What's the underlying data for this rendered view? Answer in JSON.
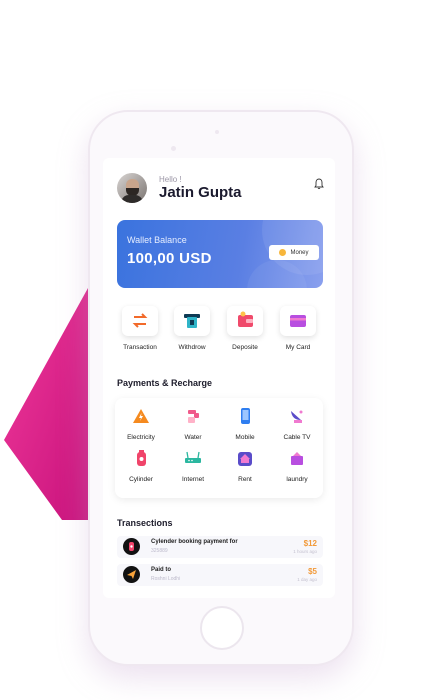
{
  "header": {
    "greeting": "Hello !",
    "user_name": "Jatin Gupta"
  },
  "wallet": {
    "label": "Wallet Balance",
    "balance": "100,00 USD",
    "money_button": "Money"
  },
  "quick_actions": [
    {
      "label": "Transaction",
      "icon": "transfer-arrows-icon"
    },
    {
      "label": "Withdrow",
      "icon": "atm-withdraw-icon"
    },
    {
      "label": "Deposite",
      "icon": "wallet-deposit-icon"
    },
    {
      "label": "My Card",
      "icon": "credit-card-icon"
    }
  ],
  "payments": {
    "title": "Payments & Recharge",
    "items": [
      {
        "label": "Electricity",
        "icon": "electricity-icon"
      },
      {
        "label": "Water",
        "icon": "water-tap-icon"
      },
      {
        "label": "Mobile",
        "icon": "mobile-phone-icon"
      },
      {
        "label": "Cable TV",
        "icon": "satellite-dish-icon"
      },
      {
        "label": "Cylinder",
        "icon": "gas-cylinder-icon"
      },
      {
        "label": "Internet",
        "icon": "router-icon"
      },
      {
        "label": "Rent",
        "icon": "house-rent-icon"
      },
      {
        "label": "laundry",
        "icon": "laundry-icon"
      }
    ]
  },
  "transactions": {
    "title": "Transections",
    "items": [
      {
        "title": "Cylender booking payment for",
        "subtitle": "325889",
        "amount": "$12",
        "time": "1 hours ago"
      },
      {
        "title": "Paid to",
        "subtitle": "Roshni Lodhi",
        "amount": "$5",
        "time": "1 day ago"
      }
    ]
  },
  "colors": {
    "wallet_gradient_start": "#3a73de",
    "wallet_gradient_end": "#8aa0ee",
    "amount": "#f29a39",
    "accent_pink": "#e0248c"
  }
}
